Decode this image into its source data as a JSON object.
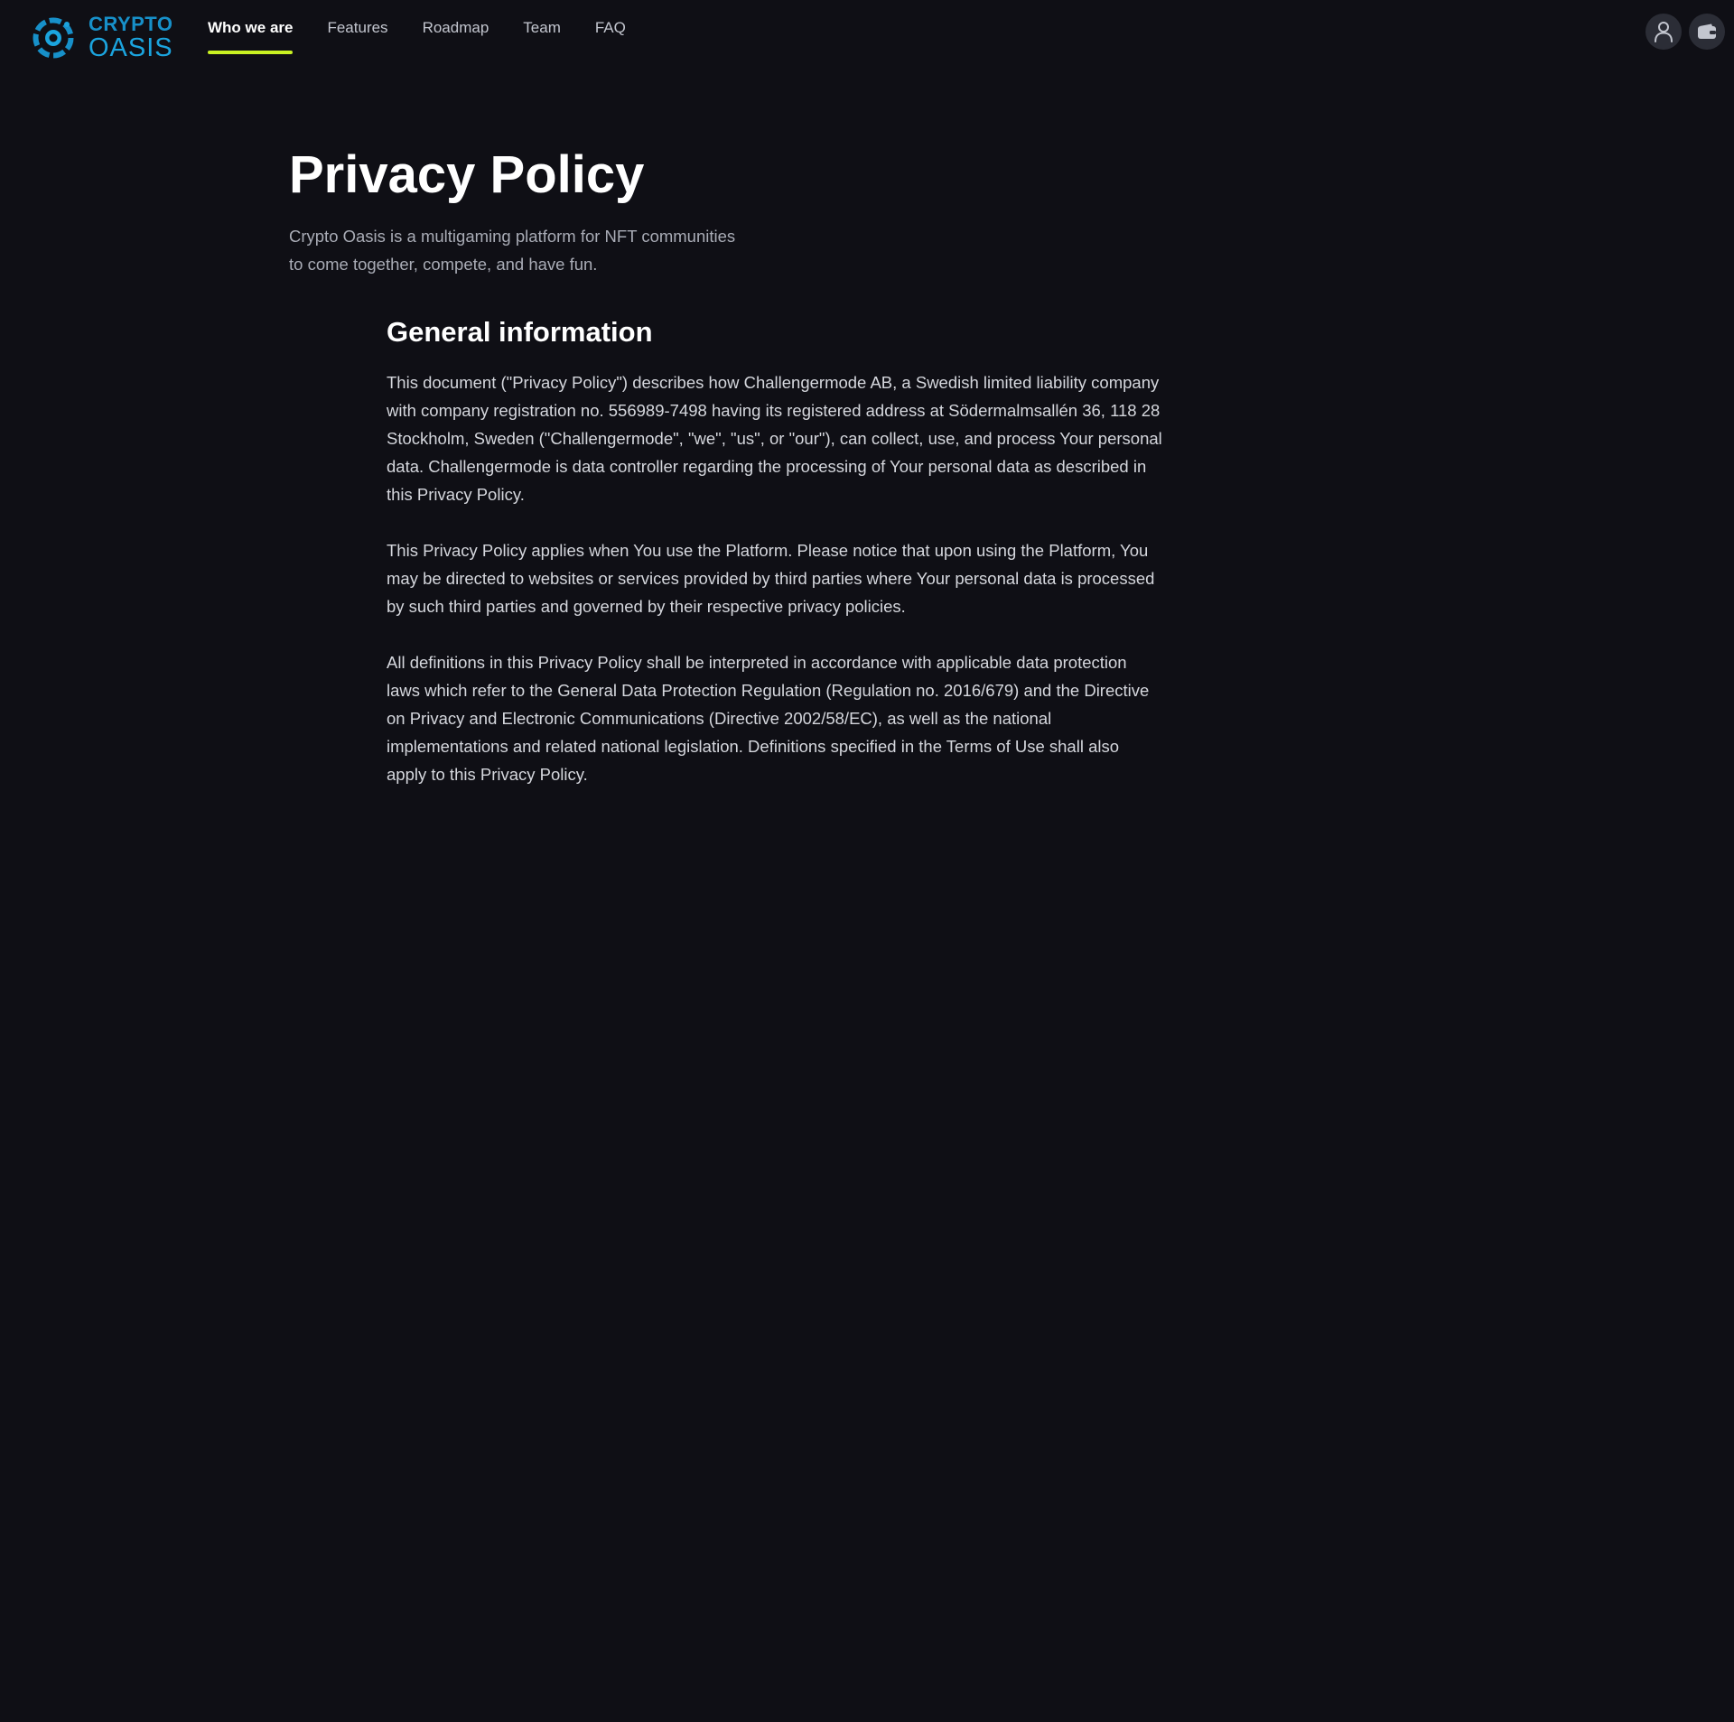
{
  "brand": {
    "line1": "CRYPTO",
    "line2": "OASIS",
    "colors": {
      "dark_blue": "#1790c9",
      "light_blue": "#1ba4de"
    }
  },
  "nav": {
    "items": [
      {
        "label": "Who we are",
        "active": true
      },
      {
        "label": "Features",
        "active": false
      },
      {
        "label": "Roadmap",
        "active": false
      },
      {
        "label": "Team",
        "active": false
      },
      {
        "label": "FAQ",
        "active": false
      }
    ],
    "active_underline_color": "#c9f222"
  },
  "header_actions": {
    "profile_icon": "user-icon",
    "wallet_icon": "wallet-icon"
  },
  "page": {
    "title": "Privacy Policy",
    "subtitle_line1": "Crypto Oasis is a multigaming platform for NFT communities",
    "subtitle_line2": "to come together, compete, and have fun."
  },
  "section": {
    "heading": "General information",
    "paragraphs": [
      " This document (\"Privacy Policy\") describes how Challengermode AB, a Swedish limited liability company with company registration no. 556989-7498 having its registered address at Södermalmsallén 36, 118 28 Stockholm, Sweden (\"Challengermode\", \"we\", \"us\", or \"our\"), can collect, use, and process Your personal data. Challengermode is data controller regarding the processing of Your personal data as described in this Privacy Policy.",
      "This Privacy Policy applies when You use the Platform. Please notice that upon using the Platform, You may be directed to websites or services provided by third parties where Your personal data is processed by such third parties and governed by their respective privacy policies.",
      "All definitions in this Privacy Policy shall be interpreted in accordance with applicable data protection laws which refer to the General Data Protection Regulation (Regulation no. 2016/679) and the Directive on Privacy and Electronic Communications (Directive 2002/58/EC), as well as the national implementations and related national legislation. Definitions specified in the Terms of Use shall also apply to this Privacy Policy."
    ]
  },
  "colors": {
    "background": "#0f0f15",
    "text_primary": "#ffffff",
    "text_secondary": "#a9acb6",
    "text_body": "#d5d7dd",
    "icon_button_bg": "#2b2d36"
  }
}
